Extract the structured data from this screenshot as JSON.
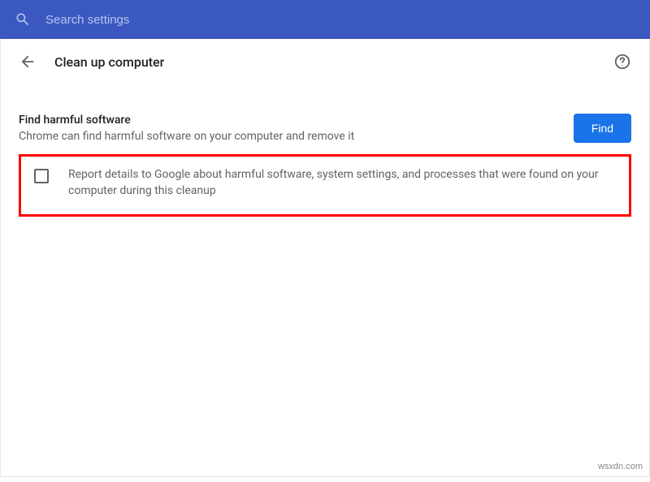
{
  "search": {
    "placeholder": "Search settings"
  },
  "header": {
    "title": "Clean up computer"
  },
  "find_section": {
    "title": "Find harmful software",
    "description": "Chrome can find harmful software on your computer and remove it",
    "button_label": "Find"
  },
  "report_section": {
    "checkbox_checked": false,
    "text": "Report details to Google about harmful software, system settings, and processes that were found on your computer during this cleanup"
  },
  "watermark": "wsxdn.com"
}
